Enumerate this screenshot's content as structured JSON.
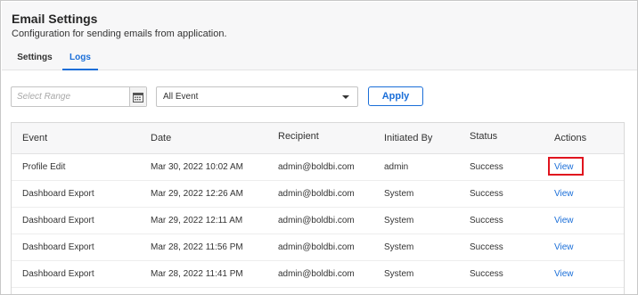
{
  "header": {
    "title": "Email Settings",
    "subtitle": "Configuration for sending emails from application.",
    "tabs": [
      {
        "label": "Settings",
        "active": false
      },
      {
        "label": "Logs",
        "active": true
      }
    ]
  },
  "filters": {
    "range_placeholder": "Select Range",
    "event_select_value": "All Event",
    "apply_label": "Apply"
  },
  "table": {
    "columns": [
      "Event",
      "Date",
      "Recipient",
      "Initiated By",
      "Status",
      "Actions"
    ],
    "rows": [
      {
        "event": "Profile Edit",
        "date": "Mar 30, 2022 10:02 AM",
        "recipient": "admin@boldbi.com",
        "initiated_by": "admin",
        "status": "Success",
        "action": "View"
      },
      {
        "event": "Dashboard Export",
        "date": "Mar 29, 2022 12:26 AM",
        "recipient": "admin@boldbi.com",
        "initiated_by": "System",
        "status": "Success",
        "action": "View"
      },
      {
        "event": "Dashboard Export",
        "date": "Mar 29, 2022 12:11 AM",
        "recipient": "admin@boldbi.com",
        "initiated_by": "System",
        "status": "Success",
        "action": "View"
      },
      {
        "event": "Dashboard Export",
        "date": "Mar 28, 2022 11:56 PM",
        "recipient": "admin@boldbi.com",
        "initiated_by": "System",
        "status": "Success",
        "action": "View"
      },
      {
        "event": "Dashboard Export",
        "date": "Mar 28, 2022 11:41 PM",
        "recipient": "admin@boldbi.com",
        "initiated_by": "System",
        "status": "Success",
        "action": "View"
      }
    ]
  },
  "icons": {
    "calendar": "calendar-icon",
    "dropdown": "chevron-down-icon",
    "filter": "filter-icon"
  },
  "colors": {
    "accent": "#1a6ed8",
    "highlight_box": "#e0141e",
    "header_bg": "#f7f7f8"
  }
}
